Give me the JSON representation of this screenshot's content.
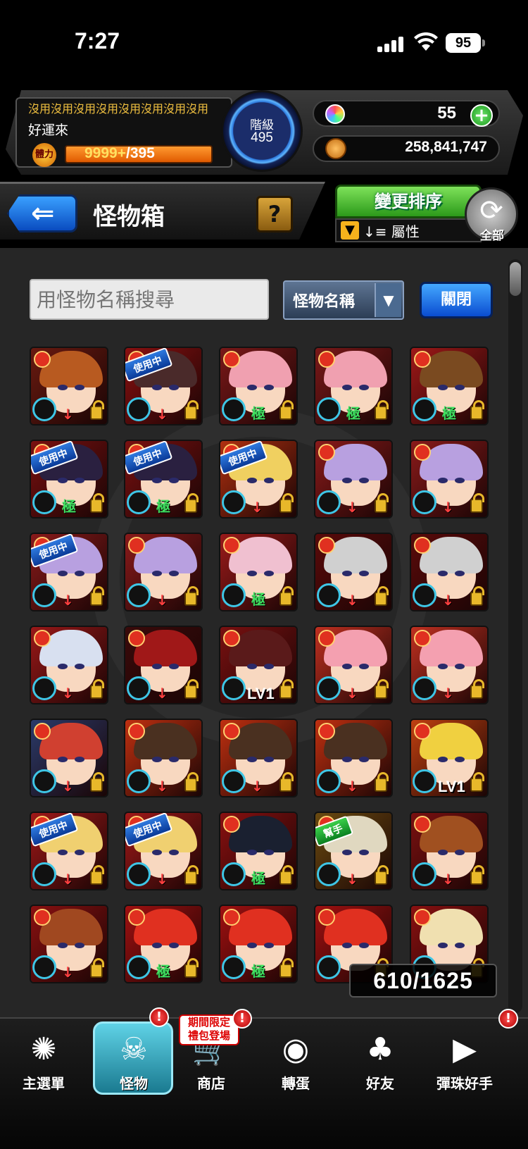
{
  "status_bar": {
    "time": "7:27",
    "battery": "95"
  },
  "player": {
    "motto": "沒用沒用沒用沒用沒用沒用沒用沒用",
    "name": "好運來",
    "stamina_icon": "體力",
    "stamina_current": "9999+",
    "stamina_max": "/395",
    "rank_label": "階級",
    "rank_value": "495"
  },
  "currency": {
    "gems": "55",
    "gem_icon": "rainbow-orb-icon",
    "coins": "258,841,747",
    "coin_icon": "gold-coin-icon"
  },
  "title_bar": {
    "title": "怪物箱",
    "help_label": "?",
    "sort_button": "變更排序",
    "sort_attribute": "屬性",
    "refresh_label": "全部"
  },
  "search": {
    "placeholder": "用怪物名稱搜尋",
    "select_value": "怪物名稱",
    "close_label": "關閉"
  },
  "box": {
    "count": "610/1625",
    "monsters": [
      {
        "hair": "#b85a20",
        "bg": "#6a1a10",
        "tag": "",
        "mark": "↓"
      },
      {
        "hair": "#4a2a2a",
        "bg": "#8a1010",
        "tag": "使用中",
        "mark": "↓"
      },
      {
        "hair": "#f0a0b0",
        "bg": "#7a1818",
        "tag": "",
        "mark": "極"
      },
      {
        "hair": "#f0a0b0",
        "bg": "#7a1818",
        "tag": "",
        "mark": "極"
      },
      {
        "hair": "#7a4a20",
        "bg": "#a01818",
        "tag": "",
        "mark": "極"
      },
      {
        "hair": "#2a2040",
        "bg": "#7a1010",
        "tag": "使用中",
        "mark": "極"
      },
      {
        "hair": "#2a2040",
        "bg": "#7a1010",
        "tag": "使用中",
        "mark": "極"
      },
      {
        "hair": "#f0d060",
        "bg": "#b03010",
        "tag": "使用中",
        "mark": "↓"
      },
      {
        "hair": "#b8a0e0",
        "bg": "#8a1a1a",
        "tag": "",
        "mark": "↓"
      },
      {
        "hair": "#b8a0e0",
        "bg": "#8a1a1a",
        "tag": "",
        "mark": "↓"
      },
      {
        "hair": "#b8a0e0",
        "bg": "#8a1a1a",
        "tag": "使用中",
        "mark": "↓"
      },
      {
        "hair": "#b8a0e0",
        "bg": "#8a1a1a",
        "tag": "",
        "mark": "↓"
      },
      {
        "hair": "#f0c0d0",
        "bg": "#9a1a1a",
        "tag": "",
        "mark": "極"
      },
      {
        "hair": "#d0d0d0",
        "bg": "#5a0a0a",
        "tag": "",
        "mark": "↓"
      },
      {
        "hair": "#d0d0d0",
        "bg": "#5a0a0a",
        "tag": "",
        "mark": "↓"
      },
      {
        "hair": "#d8e0f0",
        "bg": "#9a1818",
        "tag": "",
        "mark": "↓"
      },
      {
        "hair": "#a01818",
        "bg": "#3a0a0a",
        "tag": "",
        "mark": "↓"
      },
      {
        "hair": "#5a1a1a",
        "bg": "#7a1010",
        "tag": "",
        "mark": "LV1"
      },
      {
        "hair": "#f4a0b0",
        "bg": "#c03020",
        "tag": "",
        "mark": "↓"
      },
      {
        "hair": "#f4a0b0",
        "bg": "#c03020",
        "tag": "",
        "mark": "↓"
      },
      {
        "hair": "#d04030",
        "bg": "#2a3a6a",
        "tag": "",
        "mark": "↓"
      },
      {
        "hair": "#4a3020",
        "bg": "#c03010",
        "tag": "",
        "mark": "↓"
      },
      {
        "hair": "#4a3020",
        "bg": "#c03010",
        "tag": "",
        "mark": "↓"
      },
      {
        "hair": "#4a3020",
        "bg": "#c03010",
        "tag": "",
        "mark": "↓"
      },
      {
        "hair": "#f0d040",
        "bg": "#c04010",
        "tag": "",
        "mark": "LV1"
      },
      {
        "hair": "#f0d070",
        "bg": "#a01818",
        "tag": "使用中",
        "mark": "↓"
      },
      {
        "hair": "#f0d070",
        "bg": "#a01818",
        "tag": "使用中",
        "mark": "↓"
      },
      {
        "hair": "#1a2030",
        "bg": "#8a1010",
        "tag": "",
        "mark": "極"
      },
      {
        "hair": "#e0d8c0",
        "bg": "#6a4a10",
        "tag": "幫手",
        "mark": "↓"
      },
      {
        "hair": "#a05020",
        "bg": "#7a1010",
        "tag": "",
        "mark": "↓"
      },
      {
        "hair": "#a04820",
        "bg": "#8a1010",
        "tag": "",
        "mark": "↓"
      },
      {
        "hair": "#e03020",
        "bg": "#a01010",
        "tag": "",
        "mark": "極"
      },
      {
        "hair": "#e03020",
        "bg": "#a01010",
        "tag": "",
        "mark": "極"
      },
      {
        "hair": "#e03020",
        "bg": "#a01010",
        "tag": "",
        "mark": ""
      },
      {
        "hair": "#f0e0b0",
        "bg": "#8a1010",
        "tag": "",
        "mark": ""
      }
    ]
  },
  "nav": {
    "items": [
      {
        "label": "主選單",
        "icon": "main-menu-icon",
        "glyph": "✺"
      },
      {
        "label": "怪物",
        "icon": "monster-icon",
        "glyph": "☠"
      },
      {
        "label": "商店",
        "icon": "shop-cart-icon",
        "glyph": "🛒"
      },
      {
        "label": "轉蛋",
        "icon": "gacha-egg-icon",
        "glyph": "◉"
      },
      {
        "label": "好友",
        "icon": "friends-icon",
        "glyph": "♣"
      },
      {
        "label": "彈珠好手",
        "icon": "strike-ticket-icon",
        "glyph": "▶"
      }
    ],
    "promo": "期間限定\n禮包登場",
    "badge": "!"
  },
  "colors": {
    "accent_blue": "#0a4cc0",
    "accent_green": "#2c9a1a",
    "stamina_orange": "#e05a00",
    "active_tab": "#1a7a90"
  }
}
